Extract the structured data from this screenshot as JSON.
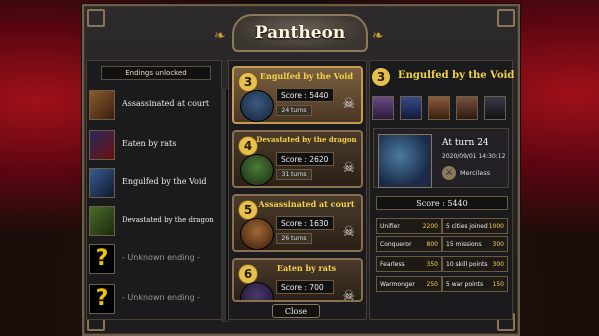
{
  "title": "Pantheon",
  "endings_header": "Endings unlocked",
  "endings": [
    {
      "label": "Assassinated at court",
      "known": true
    },
    {
      "label": "Eaten by rats",
      "known": true
    },
    {
      "label": "Engulfed by the Void",
      "known": true
    },
    {
      "label": "Devastated by the dragon",
      "known": true
    },
    {
      "label": "- Unknown ending -",
      "known": false,
      "icon": "?"
    },
    {
      "label": "- Unknown ending -",
      "known": false,
      "icon": "?"
    }
  ],
  "cards": [
    {
      "rank": "3",
      "title": "Engulfed by the Void",
      "score": "Score : 5440",
      "turns": "24 turns"
    },
    {
      "rank": "4",
      "title": "Devastated by the dragon",
      "score": "Score : 2620",
      "turns": "31 turns"
    },
    {
      "rank": "5",
      "title": "Assassinated at court",
      "score": "Score : 1630",
      "turns": "26 turns"
    },
    {
      "rank": "6",
      "title": "Eaten by rats",
      "score": "Score : 700",
      "turns": ""
    }
  ],
  "close_label": "Close",
  "detail": {
    "rank": "3",
    "title": "Engulfed by the Void",
    "turn": "At turn 24",
    "date": "2020/09/01 14:30:12",
    "difficulty": "Merciless",
    "score": "Score : 5440",
    "stats": [
      {
        "name": "Unifier",
        "value": "2200"
      },
      {
        "name": "5 cities joined",
        "value": "1000"
      },
      {
        "name": "Conqueror",
        "value": "800"
      },
      {
        "name": "15 missions",
        "value": "300"
      },
      {
        "name": "Fearless",
        "value": "350"
      },
      {
        "name": "10 skill points",
        "value": "300"
      },
      {
        "name": "Warmonger",
        "value": "250"
      },
      {
        "name": "5 war points",
        "value": "150"
      }
    ]
  },
  "colors": {
    "accent": "#f3d44a",
    "curtain": "#a0101a"
  }
}
